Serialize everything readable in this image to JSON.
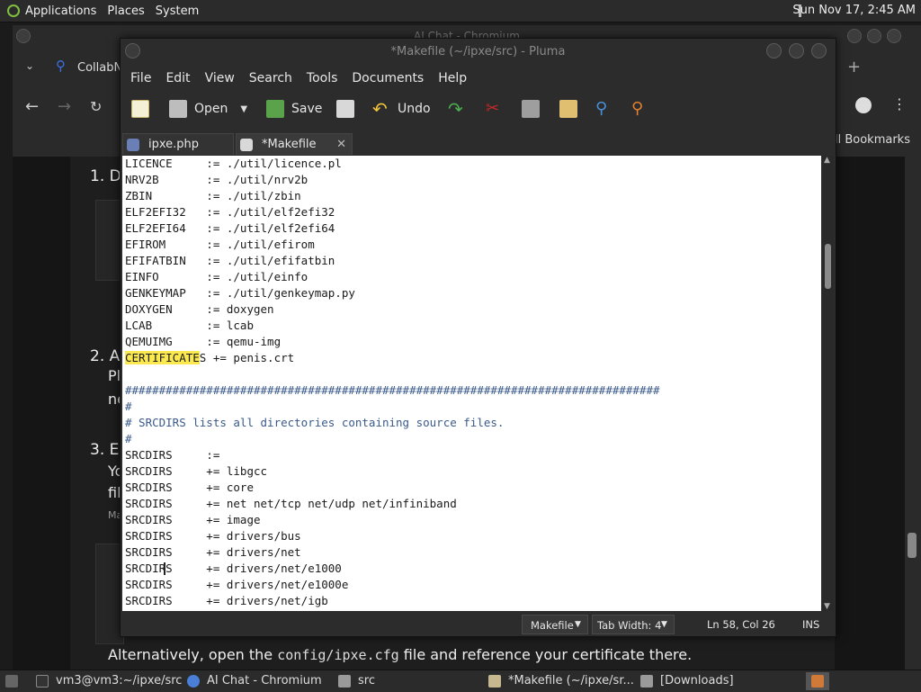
{
  "top_panel": {
    "menus": [
      "Applications",
      "Places",
      "System"
    ],
    "clock": "Sun Nov 17,  2:45 AM"
  },
  "chromium": {
    "title": "AI Chat - Chromium",
    "tab_label": "CollabN",
    "bookmarks_label": "ll Bookmarks",
    "steps": [
      {
        "label": "1. D"
      },
      {
        "label": "2. A"
      },
      {
        "label": "3. E"
      }
    ],
    "partial_text": [
      "Pl",
      "ne",
      "Yo",
      "fil",
      "Ma"
    ],
    "bottom_text_before": "Alternatively, open the ",
    "bottom_code": "config/ipxe.cfg",
    "bottom_text_after": " file and reference your certificate there."
  },
  "pluma": {
    "title": "*Makefile (~/ipxe/src) - Pluma",
    "menus": [
      "File",
      "Edit",
      "View",
      "Search",
      "Tools",
      "Documents",
      "Help"
    ],
    "toolbar": {
      "open_label": "Open",
      "save_label": "Save",
      "undo_label": "Undo"
    },
    "tabs": [
      {
        "label": "ipxe.php",
        "active": false
      },
      {
        "label": "*Makefile",
        "active": true
      }
    ],
    "lines": [
      "LICENCE     := ./util/licence.pl",
      "NRV2B       := ./util/nrv2b",
      "ZBIN        := ./util/zbin",
      "ELF2EFI32   := ./util/elf2efi32",
      "ELF2EFI64   := ./util/elf2efi64",
      "EFIROM      := ./util/efirom",
      "EFIFATBIN   := ./util/efifatbin",
      "EINFO       := ./util/einfo",
      "GENKEYMAP   := ./util/genkeymap.py",
      "DOXYGEN     := doxygen",
      "LCAB        := lcab",
      "QEMUIMG     := qemu-img",
      "CERTIFICATES += penis.crt",
      "",
      "###############################################################################",
      "#",
      "# SRCDIRS lists all directories containing source files.",
      "#",
      "SRCDIRS     :=",
      "SRCDIRS     += libgcc",
      "SRCDIRS     += core",
      "SRCDIRS     += net net/tcp net/udp net/infiniband",
      "SRCDIRS     += image",
      "SRCDIRS     += drivers/bus",
      "SRCDIRS     += drivers/net",
      "SRCDIRS     += drivers/net/e1000",
      "SRCDIRS     += drivers/net/e1000e",
      "SRCDIRS     += drivers/net/igb"
    ],
    "highlight_word": "CERTIFICATE",
    "status": {
      "language": "Makefile",
      "tab_width": "Tab Width:  4",
      "position": "Ln 58, Col 26",
      "mode": "INS"
    }
  },
  "taskbar": {
    "items": [
      "vm3@vm3:~/ipxe/src",
      "AI Chat - Chromium",
      "src",
      "*Makefile (~/ipxe/sr...",
      "[Downloads]"
    ]
  }
}
